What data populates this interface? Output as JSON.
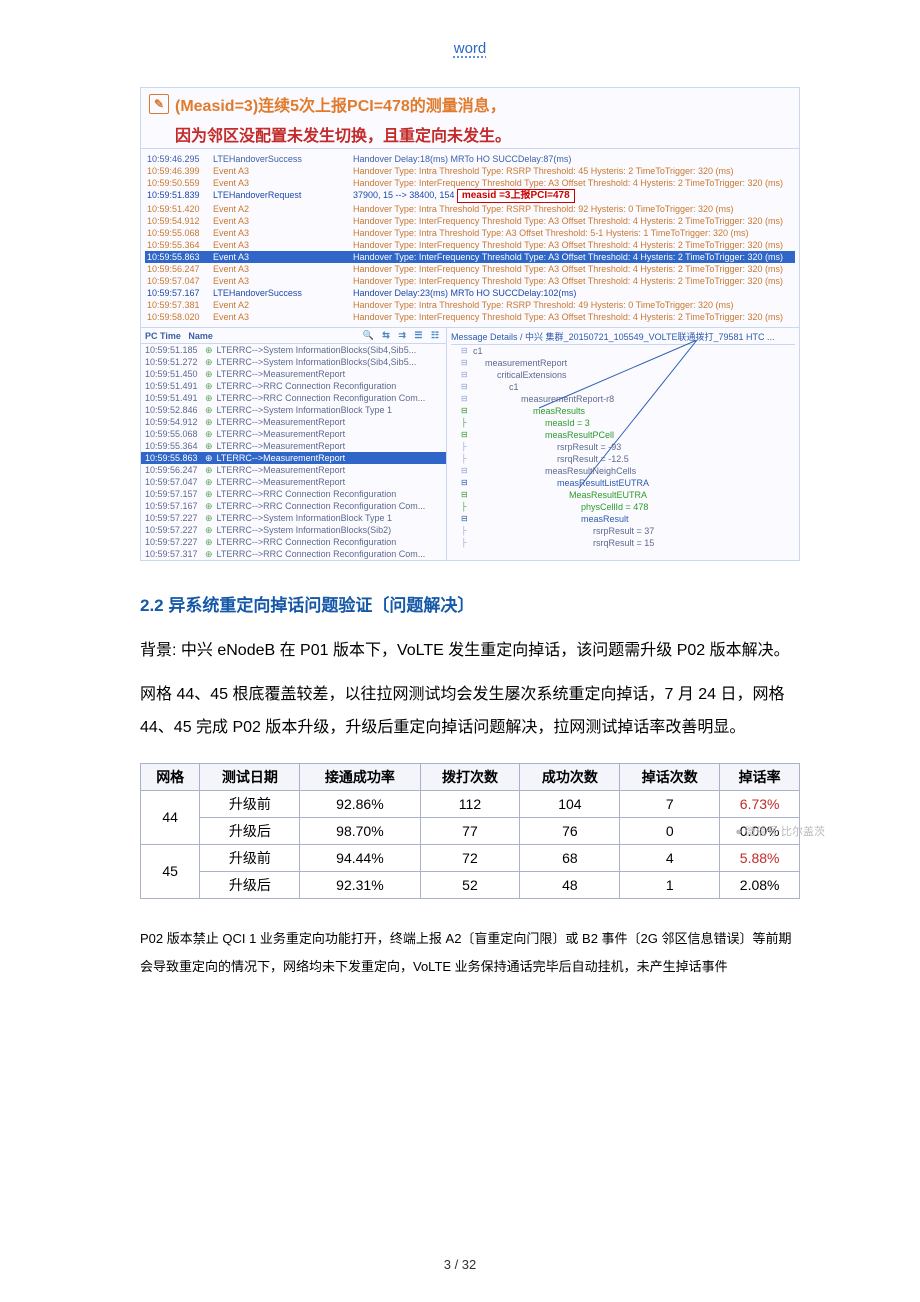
{
  "header": {
    "label": "word"
  },
  "shot": {
    "title_line1_part1": "(Measid=3)连续5次上报PCI=478的测量消息，",
    "title_line2": "因为邻区没配置未发生切换，且重定向未发生。",
    "badge": "measid =3上报PCI=478",
    "upper": [
      {
        "t": "10:59:46.295",
        "e": "LTEHandoverSuccess",
        "d": "Handover Delay:18(ms) MRTo HO SUCCDelay:87(ms)",
        "cls": "blue"
      },
      {
        "t": "10:59:46.399",
        "e": "Event A3",
        "d": "Handover Type: Intra  Threshold Type: RSRP  Threshold: 45  Hysteris: 2  TimeToTrigger: 320 (ms)",
        "cls": "orange"
      },
      {
        "t": "10:59:50.559",
        "e": "Event A3",
        "d": "Handover Type: InterFrequency  Threshold Type: A3 Offset  Threshold: 4  Hysteris: 2  TimeToTrigger: 320 (ms)",
        "cls": "orange"
      },
      {
        "t": "10:59:51.839",
        "e": "LTEHandoverRequest",
        "d": "37900, 15 --> 38400, 154",
        "cls": "dblue",
        "badge": true
      },
      {
        "t": "10:59:51.420",
        "e": "Event A2",
        "d": "Handover Type: Intra  Threshold Type: RSRP  Threshold: 92  Hysteris: 0  TimeToTrigger: 320 (ms)",
        "cls": "orange"
      },
      {
        "t": "10:59:54.912",
        "e": "Event A3",
        "d": "Handover Type: InterFrequency  Threshold Type: A3 Offset  Threshold: 4  Hysteris: 2  TimeToTrigger: 320 (ms)",
        "cls": "orange"
      },
      {
        "t": "10:59:55.068",
        "e": "Event A3",
        "d": "Handover Type: Intra  Threshold Type: A3 Offset  Threshold: 5-1  Hysteris: 1  TimeToTrigger: 320 (ms)",
        "cls": "orange"
      },
      {
        "t": "10:59:55.364",
        "e": "Event A3",
        "d": "Handover Type: InterFrequency  Threshold Type: A3 Offset  Threshold: 4  Hysteris: 2  TimeToTrigger: 320 (ms)",
        "cls": "orange"
      },
      {
        "t": "10:59:55.863",
        "e": "Event A3",
        "d": "Handover Type: InterFrequency  Threshold Type: A3 Offset  Threshold: 4  Hysteris: 2  TimeToTrigger: 320 (ms)",
        "cls": "sel"
      },
      {
        "t": "10:59:56.247",
        "e": "Event A3",
        "d": "Handover Type: InterFrequency  Threshold Type: A3 Offset  Threshold: 4  Hysteris: 2  TimeToTrigger: 320 (ms)",
        "cls": "orange"
      },
      {
        "t": "10:59:57.047",
        "e": "Event A3",
        "d": "Handover Type: InterFrequency  Threshold Type: A3 Offset  Threshold: 4  Hysteris: 2  TimeToTrigger: 320 (ms)",
        "cls": "orange"
      },
      {
        "t": "10:59:57.167",
        "e": "LTEHandoverSuccess",
        "d": "Handover Delay:23(ms) MRTo HO SUCCDelay:102(ms)",
        "cls": "dblue"
      },
      {
        "t": "10:59:57.381",
        "e": "Event A2",
        "d": "Handover Type: Intra  Threshold Type: RSRP  Threshold: 49  Hysteris: 0  TimeToTrigger: 320 (ms)",
        "cls": "orange"
      },
      {
        "t": "10:59:58.020",
        "e": "Event A3",
        "d": "Handover Type: InterFrequency  Threshold Type: A3 Offset  Threshold: 4  Hysteris: 2  TimeToTrigger: 320 (ms)",
        "cls": "orange"
      }
    ],
    "list_hdr_time": "PC Time",
    "list_hdr_name": "Name",
    "tools_glyphs": "🔍 ⇆ ⇉ ☰ ☷",
    "list": [
      {
        "t": "10:59:51.185",
        "n": "LTERRC-->System InformationBlocks(Sib4,Sib5...",
        "sel": false
      },
      {
        "t": "10:59:51.272",
        "n": "LTERRC-->System InformationBlocks(Sib4,Sib5...",
        "sel": false
      },
      {
        "t": "10:59:51.450",
        "n": "LTERRC-->MeasurementReport",
        "sel": false
      },
      {
        "t": "10:59:51.491",
        "n": "LTERRC-->RRC Connection Reconfiguration",
        "sel": false
      },
      {
        "t": "10:59:51.491",
        "n": "LTERRC-->RRC Connection Reconfiguration Com...",
        "sel": false
      },
      {
        "t": "10:59:52.846",
        "n": "LTERRC-->System InformationBlock Type 1",
        "sel": false
      },
      {
        "t": "10:59:54.912",
        "n": "LTERRC-->MeasurementReport",
        "sel": false
      },
      {
        "t": "10:59:55.068",
        "n": "LTERRC-->MeasurementReport",
        "sel": false
      },
      {
        "t": "10:59:55.364",
        "n": "LTERRC-->MeasurementReport",
        "sel": false
      },
      {
        "t": "10:59:55.863",
        "n": "LTERRC-->MeasurementReport",
        "sel": true
      },
      {
        "t": "10:59:56.247",
        "n": "LTERRC-->MeasurementReport",
        "sel": false
      },
      {
        "t": "10:59:57.047",
        "n": "LTERRC-->MeasurementReport",
        "sel": false
      },
      {
        "t": "10:59:57.157",
        "n": "LTERRC-->RRC Connection Reconfiguration",
        "sel": false
      },
      {
        "t": "10:59:57.167",
        "n": "LTERRC-->RRC Connection Reconfiguration Com...",
        "sel": false
      },
      {
        "t": "10:59:57.227",
        "n": "LTERRC-->System InformationBlock Type 1",
        "sel": false
      },
      {
        "t": "10:59:57.227",
        "n": "LTERRC-->System InformationBlocks(Sib2)",
        "sel": false
      },
      {
        "t": "10:59:57.227",
        "n": "LTERRC-->RRC Connection Reconfiguration",
        "sel": false
      },
      {
        "t": "10:59:57.317",
        "n": "LTERRC-->RRC Connection Reconfiguration Com...",
        "sel": false
      }
    ],
    "tree_title": "Message Details / 中兴 集群_20150721_105549_VOLTE联通拨打_79581 HTC ...",
    "tree": {
      "c1": "c1",
      "mr": "measurementReport",
      "ce": "criticalExtensions",
      "c1b": "c1",
      "mrr8": "measurementReport-r8",
      "mres": "measResults",
      "mid": "measId = 3",
      "mrpc": "measResultPCell",
      "rsrp1": "rsrpResult = -93",
      "rsrq1": "rsrqResult = -12.5",
      "mrnc": "measResultNeighCells",
      "mrle": "measResultListEUTRA",
      "mre": "MeasResultEUTRA",
      "pci": "physCellId = 478",
      "mres2": "measResult",
      "rsrp2": "rsrpResult = 37",
      "rsrq2": "rsrqResult = 15"
    }
  },
  "section": {
    "heading": "2.2  异系统重定向掉话问题验证〔问题解决〕",
    "p1": "背景: 中兴 eNodeB 在 P01 版本下，VoLTE 发生重定向掉话，该问题需升级 P02 版本解决。",
    "p2": "网格 44、45 根底覆盖较差，以往拉网测试均会发生屡次系统重定向掉话，7 月 24 日，网格 44、45 完成 P02 版本升级，升级后重定向掉话问题解决，拉网测试掉话率改善明显。"
  },
  "table": {
    "headers": [
      "网格",
      "测试日期",
      "接通成功率",
      "拨打次数",
      "成功次数",
      "掉话次数",
      "掉话率"
    ],
    "watermark": "● 微信号  比尔盖茨",
    "rows": [
      {
        "g": "44",
        "date": "升级前",
        "rate": "92.86%",
        "dials": "112",
        "succ": "104",
        "drops": "7",
        "drate": "6.73%",
        "bad": true
      },
      {
        "g": "",
        "date": "升级后",
        "rate": "98.70%",
        "dials": "77",
        "succ": "76",
        "drops": "0",
        "drate": "0.00%",
        "bad": false
      },
      {
        "g": "45",
        "date": "升级前",
        "rate": "94.44%",
        "dials": "72",
        "succ": "68",
        "drops": "4",
        "drate": "5.88%",
        "bad": true
      },
      {
        "g": "",
        "date": "升级后",
        "rate": "92.31%",
        "dials": "52",
        "succ": "48",
        "drops": "1",
        "drate": "2.08%",
        "bad": false
      }
    ]
  },
  "p3": "P02 版本禁止 QCI 1 业务重定向功能打开，终端上报 A2〔盲重定向门限〕或 B2 事件〔2G 邻区信息错误〕等前期会导致重定向的情况下，网络均未下发重定向，VoLTE 业务保持通话完毕后自动挂机，未产生掉话事件",
  "footer": {
    "page": "3 / 32"
  }
}
